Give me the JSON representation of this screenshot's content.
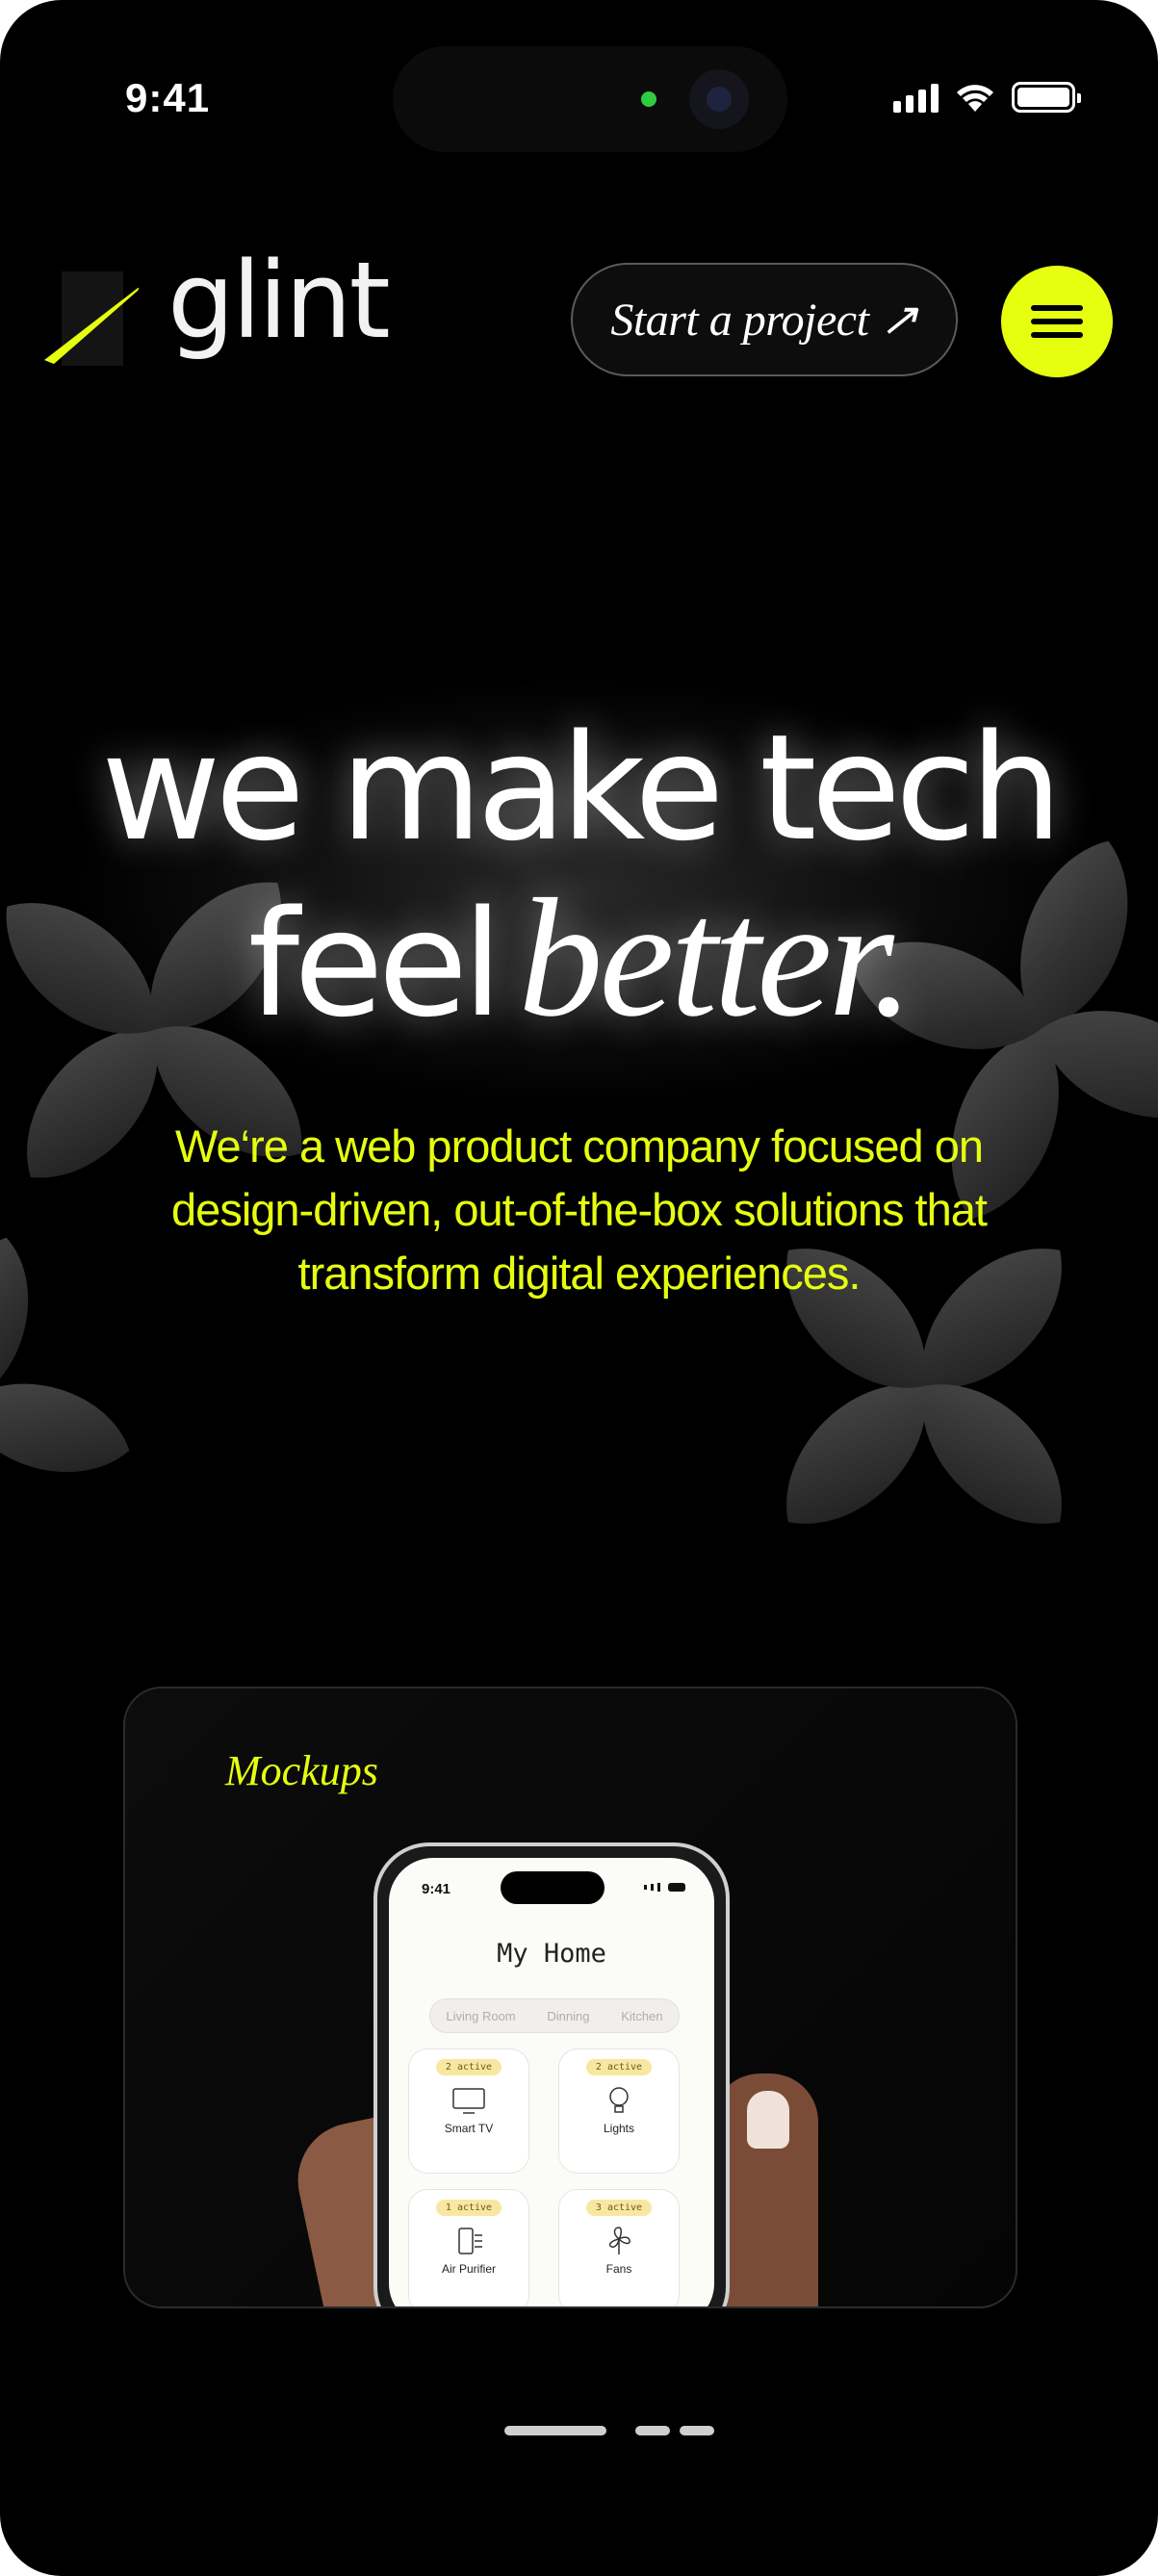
{
  "status_bar": {
    "time": "9:41"
  },
  "header": {
    "logo_text": "glint",
    "cta_label": "Start a project ↗",
    "menu_icon": "hamburger-menu-icon"
  },
  "hero": {
    "line1": "we make tech",
    "line2_plain": "feel",
    "line2_italic": "better.",
    "subtitle": "We‘re a web product company focused on design-driven, out-of-the-box solutions that transform digital experiences."
  },
  "card": {
    "label": "Mockups",
    "mockup": {
      "time": "9:41",
      "title": "My Home",
      "tabs": [
        "Living Room",
        "Dinning",
        "Kitchen"
      ],
      "tiles": [
        {
          "badge": "2 active",
          "label": "Smart TV",
          "icon": "tv-icon"
        },
        {
          "badge": "2 active",
          "label": "Lights",
          "icon": "bulb-icon"
        },
        {
          "badge": "1 active",
          "label": "Air Purifier",
          "icon": "air-purifier-icon"
        },
        {
          "badge": "3 active",
          "label": "Fans",
          "icon": "fan-icon"
        }
      ]
    }
  },
  "colors": {
    "accent": "#e6ff0f",
    "background": "#000000",
    "text": "#ffffff"
  },
  "pager": {
    "pages": 3,
    "active_index": 0
  }
}
